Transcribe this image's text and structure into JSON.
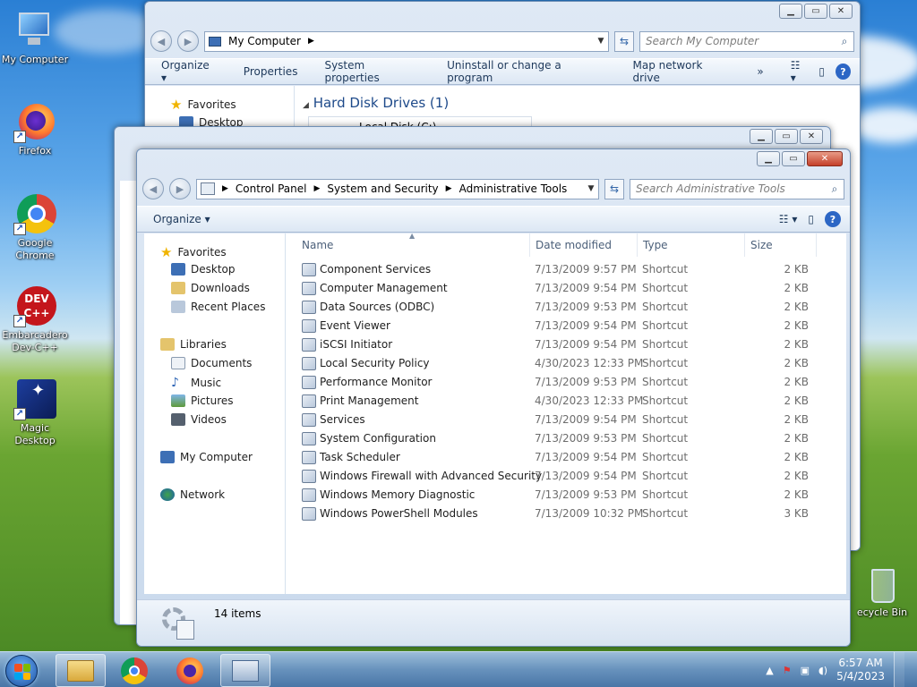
{
  "desktop": {
    "icons": [
      {
        "label": "My Computer"
      },
      {
        "label": "Firefox"
      },
      {
        "label": "Google Chrome"
      },
      {
        "label": "Embarcadero Dev-C++",
        "badge": "DEV C++"
      },
      {
        "label": "Magic Desktop"
      },
      {
        "label": "ecycle Bin"
      }
    ]
  },
  "back_window": {
    "address": "My Computer",
    "search_placeholder": "Search My Computer",
    "commands": [
      "Organize",
      "Properties",
      "System properties",
      "Uninstall or change a program",
      "Map network drive",
      "»"
    ],
    "nav": [
      "Favorites",
      "Desktop"
    ],
    "section_title": "Hard Disk Drives (1)",
    "drive_label": "Local Disk (C:)"
  },
  "front_window": {
    "breadcrumb": [
      "Control Panel",
      "System and Security",
      "Administrative Tools"
    ],
    "search_placeholder": "Search Administrative Tools",
    "organize_label": "Organize",
    "nav": {
      "favorites": "Favorites",
      "desktop": "Desktop",
      "downloads": "Downloads",
      "recent": "Recent Places",
      "libraries": "Libraries",
      "documents": "Documents",
      "music": "Music",
      "pictures": "Pictures",
      "videos": "Videos",
      "computer": "My Computer",
      "network": "Network"
    },
    "columns": {
      "name": "Name",
      "date": "Date modified",
      "type": "Type",
      "size": "Size"
    },
    "files": [
      {
        "name": "Component Services",
        "date": "7/13/2009 9:57 PM",
        "type": "Shortcut",
        "size": "2 KB"
      },
      {
        "name": "Computer Management",
        "date": "7/13/2009 9:54 PM",
        "type": "Shortcut",
        "size": "2 KB"
      },
      {
        "name": "Data Sources (ODBC)",
        "date": "7/13/2009 9:53 PM",
        "type": "Shortcut",
        "size": "2 KB"
      },
      {
        "name": "Event Viewer",
        "date": "7/13/2009 9:54 PM",
        "type": "Shortcut",
        "size": "2 KB"
      },
      {
        "name": "iSCSI Initiator",
        "date": "7/13/2009 9:54 PM",
        "type": "Shortcut",
        "size": "2 KB"
      },
      {
        "name": "Local Security Policy",
        "date": "4/30/2023 12:33 PM",
        "type": "Shortcut",
        "size": "2 KB"
      },
      {
        "name": "Performance Monitor",
        "date": "7/13/2009 9:53 PM",
        "type": "Shortcut",
        "size": "2 KB"
      },
      {
        "name": "Print Management",
        "date": "4/30/2023 12:33 PM",
        "type": "Shortcut",
        "size": "2 KB"
      },
      {
        "name": "Services",
        "date": "7/13/2009 9:54 PM",
        "type": "Shortcut",
        "size": "2 KB"
      },
      {
        "name": "System Configuration",
        "date": "7/13/2009 9:53 PM",
        "type": "Shortcut",
        "size": "2 KB"
      },
      {
        "name": "Task Scheduler",
        "date": "7/13/2009 9:54 PM",
        "type": "Shortcut",
        "size": "2 KB"
      },
      {
        "name": "Windows Firewall with Advanced Security",
        "date": "7/13/2009 9:54 PM",
        "type": "Shortcut",
        "size": "2 KB"
      },
      {
        "name": "Windows Memory Diagnostic",
        "date": "7/13/2009 9:53 PM",
        "type": "Shortcut",
        "size": "2 KB"
      },
      {
        "name": "Windows PowerShell Modules",
        "date": "7/13/2009 10:32 PM",
        "type": "Shortcut",
        "size": "3 KB"
      }
    ],
    "status": "14 items"
  },
  "taskbar": {
    "time": "6:57 AM",
    "date": "5/4/2023"
  },
  "colors": {
    "accent": "#2c66c5",
    "link_text": "#1e395b"
  }
}
